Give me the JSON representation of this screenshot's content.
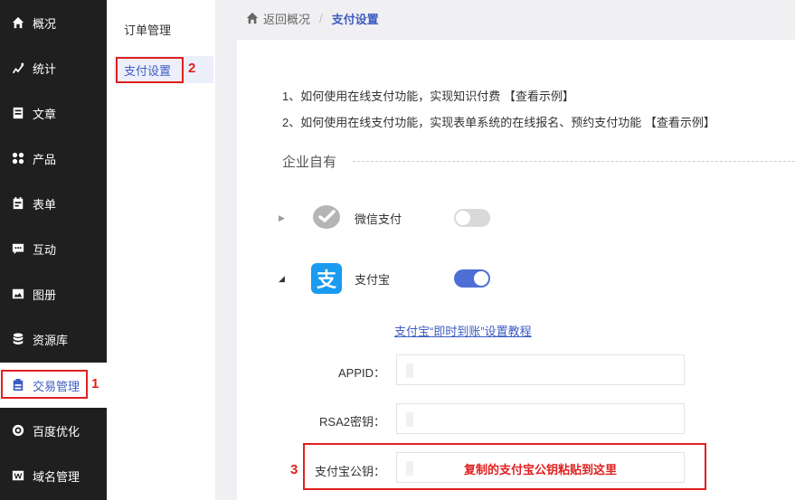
{
  "sidebar": {
    "items": [
      {
        "label": "概况",
        "icon": "home-icon"
      },
      {
        "label": "统计",
        "icon": "chart-icon"
      },
      {
        "label": "文章",
        "icon": "article-icon"
      },
      {
        "label": "产品",
        "icon": "grid-icon"
      },
      {
        "label": "表单",
        "icon": "form-icon"
      },
      {
        "label": "互动",
        "icon": "chat-icon"
      },
      {
        "label": "图册",
        "icon": "image-icon"
      },
      {
        "label": "资源库",
        "icon": "database-icon"
      },
      {
        "label": "交易管理",
        "icon": "clipboard-icon",
        "active": true
      },
      {
        "label": "百度优化",
        "icon": "target-icon"
      },
      {
        "label": "域名管理",
        "icon": "w-icon"
      }
    ]
  },
  "submenu": {
    "items": [
      {
        "label": "订单管理"
      },
      {
        "label": "支付设置",
        "active": true
      }
    ]
  },
  "annotations": {
    "n1": "1",
    "n2": "2",
    "n3": "3"
  },
  "breadcrumb": {
    "back": "返回概况",
    "separator": "/",
    "current": "支付设置"
  },
  "tips": [
    "1、如何使用在线支付功能，实现知识付费 【查看示例】",
    "2、如何使用在线支付功能，实现表单系统的在线报名、预约支付功能 【查看示例】"
  ],
  "section_title": "企业自有",
  "payments": {
    "wechat": {
      "name": "微信支付",
      "enabled": false,
      "icon": "wechat-pay-icon"
    },
    "alipay": {
      "name": "支付宝",
      "enabled": true,
      "icon": "alipay-icon",
      "icon_char": "支"
    }
  },
  "tutorial_link": "支付宝“即时到账”设置教程",
  "form": {
    "appid_label": "APPID：",
    "rsa2_label": "RSA2密钥：",
    "public_key_label": "支付宝公钥：",
    "paste_hint": "复制的支付宝公钥粘贴到这里"
  },
  "colors": {
    "accent": "#3d5cc1",
    "annotation": "#e02020",
    "sidebar": "#1f1f1f",
    "alipay": "#1a9bf0"
  }
}
